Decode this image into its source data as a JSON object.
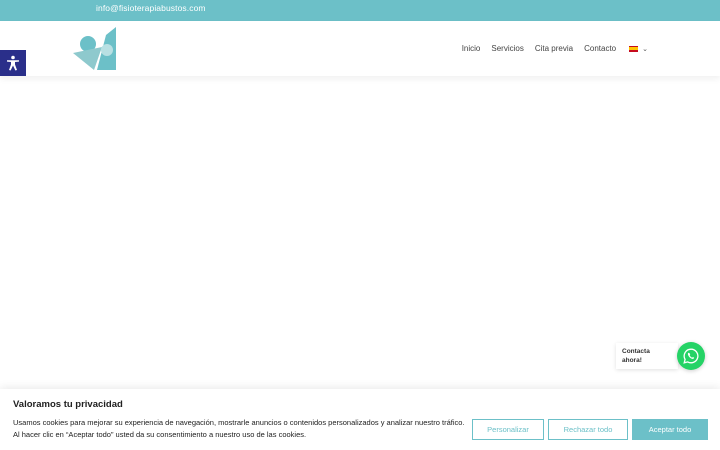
{
  "topbar": {
    "email": "info@fisioterapiabustos.com"
  },
  "nav": {
    "items": [
      {
        "label": "Inicio"
      },
      {
        "label": "Servicios"
      },
      {
        "label": "Cita previa"
      },
      {
        "label": "Contacto"
      }
    ],
    "language_icon": "spain-flag-icon"
  },
  "colors": {
    "brand": "#6cc0c8",
    "accessibility": "#2a2f8a",
    "whatsapp": "#25d366"
  },
  "whatsapp": {
    "label_line1": "Contacta",
    "label_line2": "ahora!"
  },
  "cookie_banner": {
    "title": "Valoramos tu privacidad",
    "text": "Usamos cookies para mejorar su experiencia de navegación, mostrarle anuncios o contenidos personalizados y analizar nuestro tráfico. Al hacer clic en “Aceptar todo” usted da su consentimiento a nuestro uso de las cookies.",
    "customize_label": "Personalizar",
    "reject_label": "Rechazar todo",
    "accept_label": "Aceptar todo"
  }
}
